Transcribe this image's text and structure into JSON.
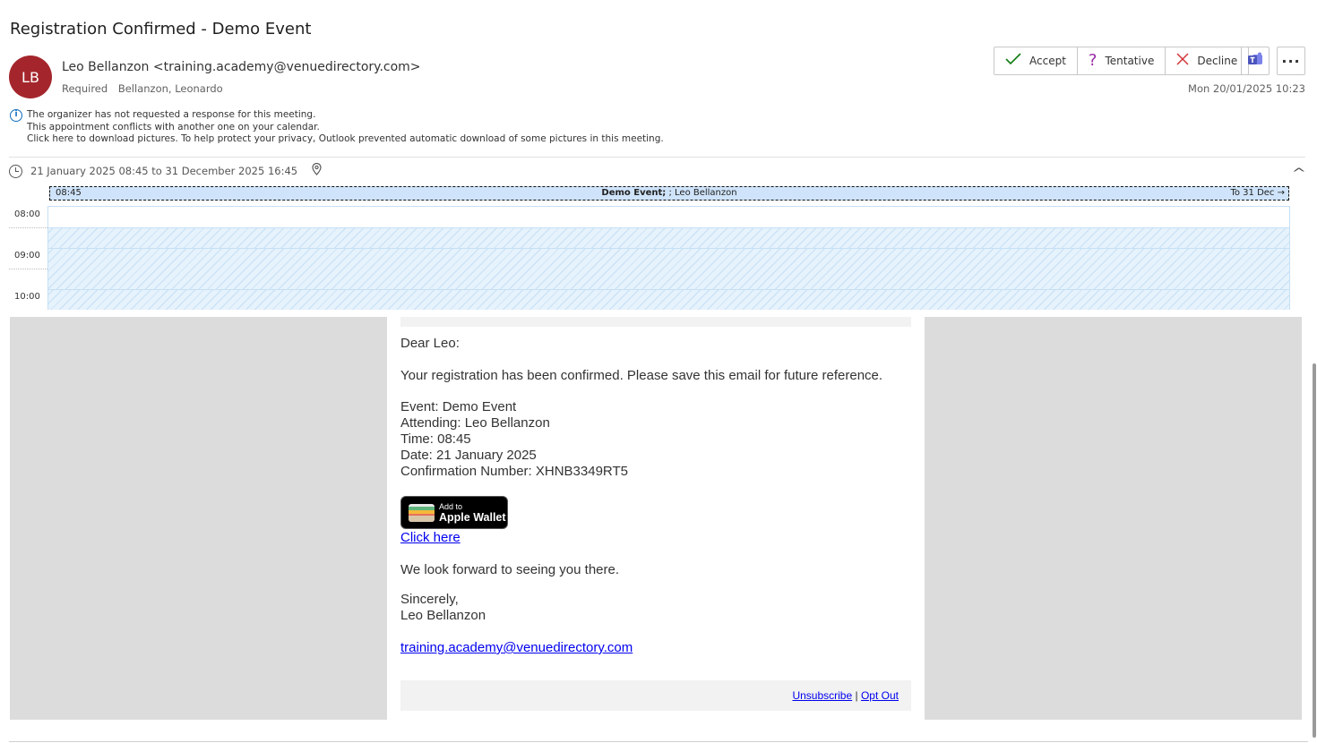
{
  "subject": "Registration Confirmed - Demo Event",
  "sender": {
    "initials": "LB",
    "display": "Leo Bellanzon <training.academy@venuedirectory.com>",
    "required_label": "Required",
    "required_attendee": "Bellanzon, Leonardo",
    "sent_date": "Mon 20/01/2025 10:23"
  },
  "rsvp": {
    "accept": "Accept",
    "tentative": "Tentative",
    "decline": "Decline"
  },
  "info": {
    "line1": "The organizer has not requested a response for this meeting.",
    "line2": "This appointment conflicts with another one on your calendar.",
    "line3": "Click here to download pictures. To help protect your privacy, Outlook prevented automatic download of some pictures in this meeting."
  },
  "meeting_time": "21 January 2025 08:45 to 31 December 2025 16:45",
  "calendar": {
    "event_start": "08:45",
    "event_title": "Demo Event;",
    "event_organizer": "; Leo Bellanzon",
    "event_end": "To 31 Dec",
    "times": [
      "08:00",
      "09:00",
      "10:00"
    ]
  },
  "email": {
    "greeting": "Dear Leo:",
    "intro": "Your registration has been confirmed. Please save this email for future reference.",
    "event": "Event: Demo Event",
    "attending": "Attending: Leo Bellanzon",
    "time": "Time: 08:45",
    "date": "Date: 21 January 2025",
    "confirmation": "Confirmation Number: XHNB3349RT5",
    "wallet_small": "Add to",
    "wallet_big": "Apple Wallet",
    "click_here": "Click here",
    "forward": "We look forward to seeing you there.",
    "sincerely": "Sincerely,",
    "signature": "Leo Bellanzon",
    "email_link": "training.academy@venuedirectory.com",
    "unsubscribe": "Unsubscribe",
    "separator": "|",
    "opt_out": "Opt Out"
  },
  "colors": {
    "avatar": "#a4262c",
    "accept": "#107c10",
    "tentative": "#9a2aa6",
    "decline": "#d13438",
    "calendar_event": "#cfe4fa",
    "teams": "#4b53bc"
  },
  "icons": [
    "checkmark-icon",
    "question-icon",
    "x-icon",
    "teams-icon",
    "more-icon",
    "info-icon",
    "clock-icon",
    "location-pin-icon",
    "chevron-up-icon",
    "arrow-right-icon",
    "wallet-icon"
  ]
}
